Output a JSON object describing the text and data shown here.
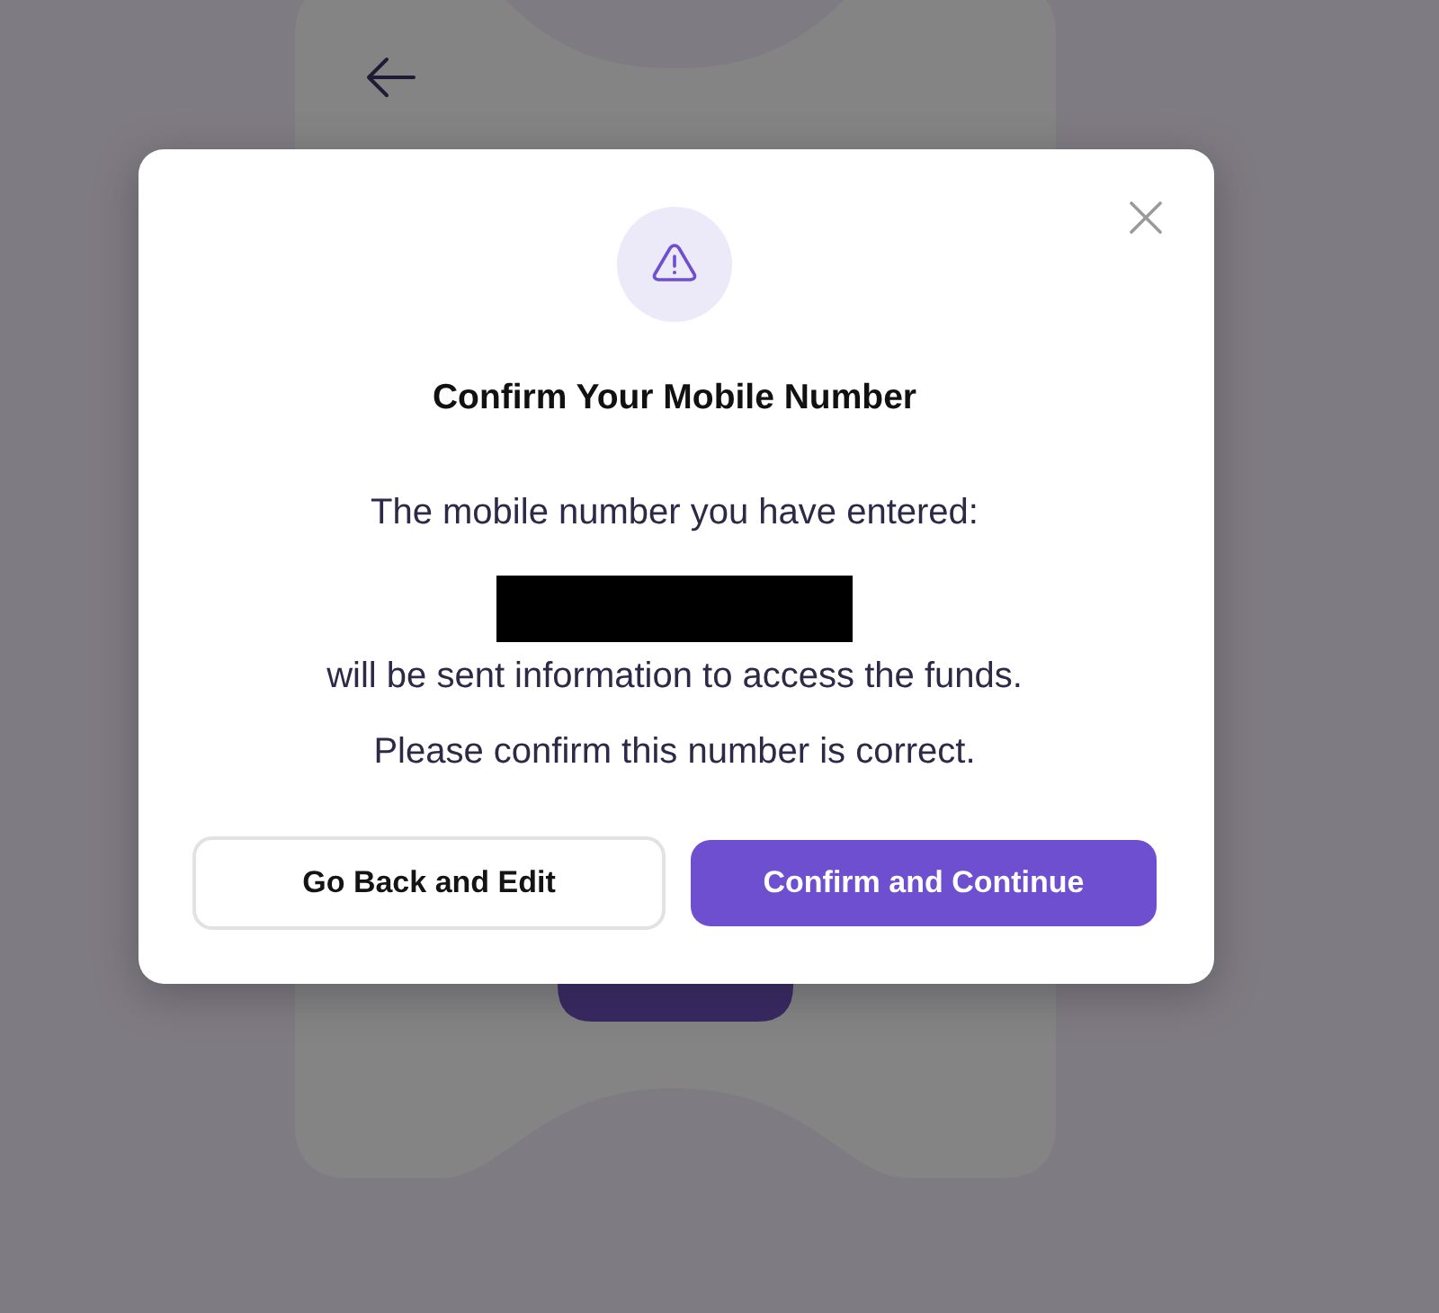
{
  "dialog": {
    "title": "Confirm Your Mobile Number",
    "intro": "The mobile number you have entered:",
    "follow_up": "will be sent information to access the funds.",
    "prompt": "Please confirm this number is correct.",
    "buttons": [
      {
        "label": "Go Back and Edit",
        "kind": "secondary"
      },
      {
        "label": "Confirm and Continue",
        "kind": "primary"
      }
    ]
  }
}
